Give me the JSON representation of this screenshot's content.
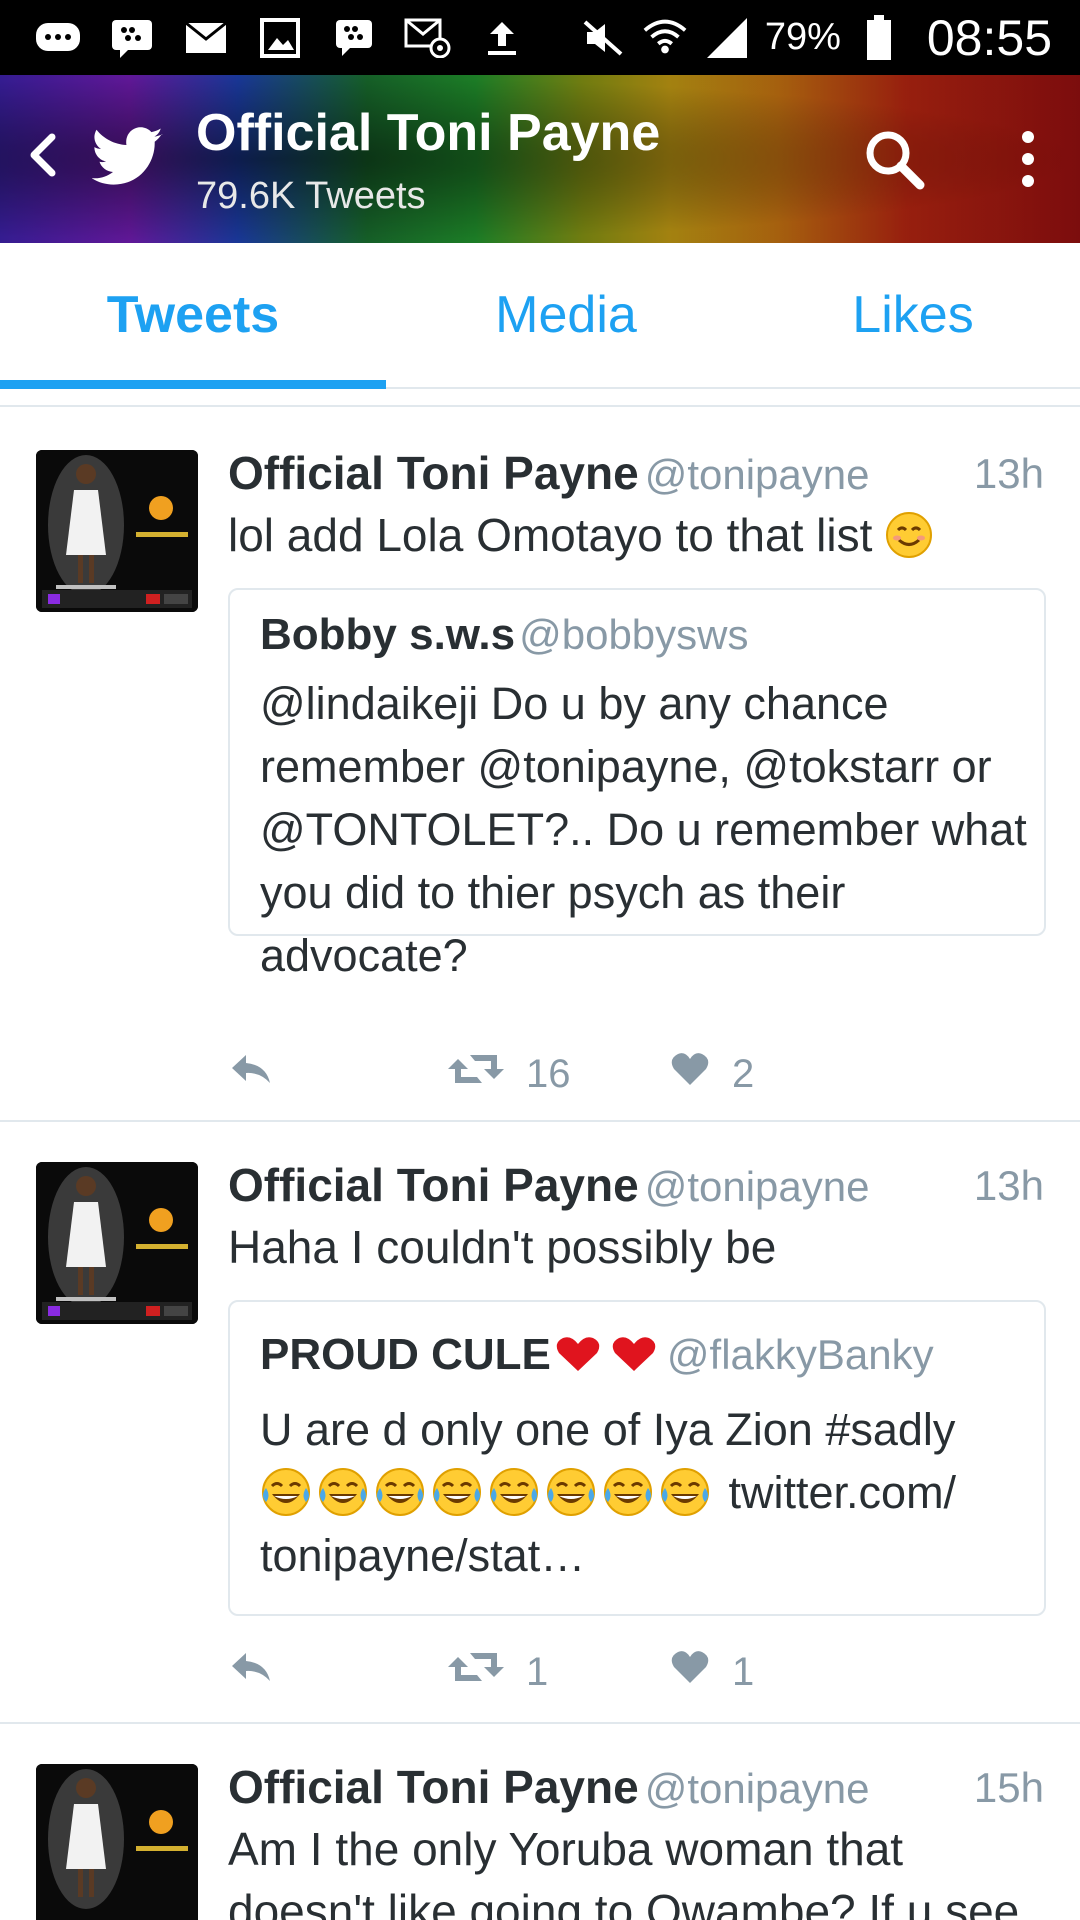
{
  "status_bar": {
    "battery": "79%",
    "time": "08:55"
  },
  "header": {
    "title": "Official Toni Payne",
    "subtitle": "79.6K Tweets"
  },
  "tabs": [
    "Tweets",
    "Media",
    "Likes"
  ],
  "active_tab": "Tweets",
  "colors": {
    "accent": "#1da1f2",
    "muted": "#8899a6",
    "text": "#292f33"
  },
  "tweets": [
    {
      "name": "Official Toni Payne",
      "handle": "@tonipayne",
      "time": "13h",
      "text": "lol add Lola Omotayo to that list",
      "quote": {
        "name": "Bobby s.w.s",
        "handle": "@bobbysws",
        "text": "@lindaikeji  Do u by any chance remember @tonipayne, @tokstarr or @TONTOLET?.. Do u remember what you did to thier psych as their advocate?"
      },
      "retweets": "16",
      "likes": "2"
    },
    {
      "name": "Official Toni Payne",
      "handle": "@tonipayne",
      "time": "13h",
      "text": "Haha I couldn't possibly be",
      "quote": {
        "name": "PROUD CULE",
        "handle": "@flakkyBanky",
        "text_line1": "U are d only one of Iya Zion #sadly",
        "text_line2_suffix": " twitter.com/",
        "text_line3": "tonipayne/stat…"
      },
      "retweets": "1",
      "likes": "1"
    },
    {
      "name": "Official Toni Payne",
      "handle": "@tonipayne",
      "time": "15h",
      "text": "Am I the only Yoruba woman that doesn't like going to Owambe? If u see"
    }
  ]
}
